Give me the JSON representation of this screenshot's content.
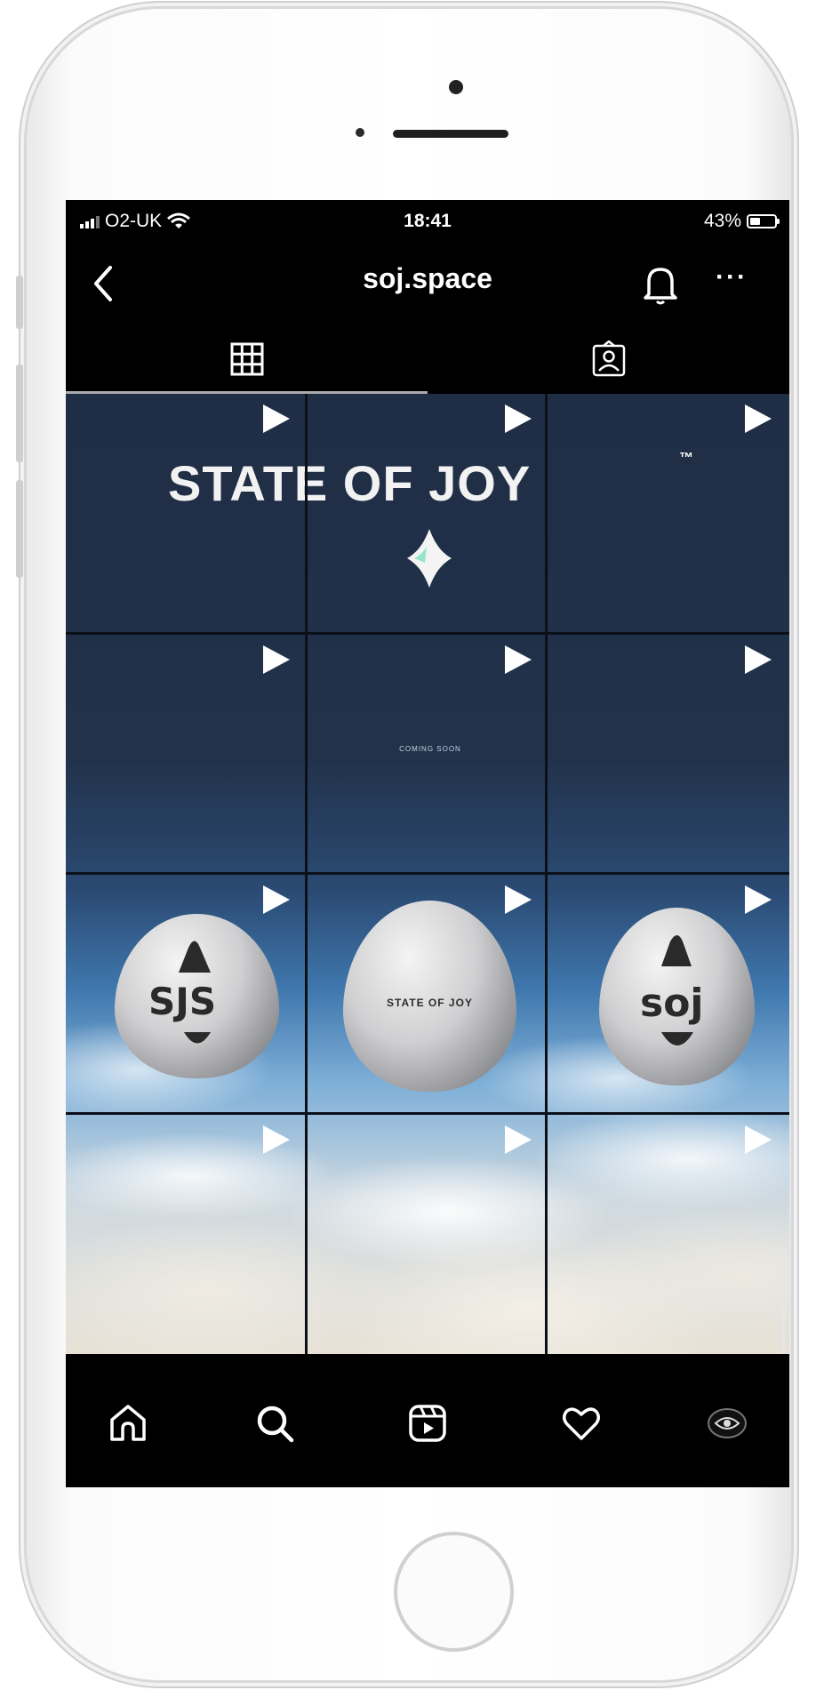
{
  "status_bar": {
    "carrier": "O2-UK",
    "time": "18:41",
    "battery": "43%",
    "battery_level": 0.43
  },
  "header": {
    "title": "soj.space",
    "back_icon": "chevron-left-icon",
    "notification_icon": "bell-icon",
    "more_label": "···"
  },
  "tabs": [
    {
      "icon": "grid-icon",
      "selected": true
    },
    {
      "icon": "tagged-person-icon",
      "selected": false
    }
  ],
  "grid": {
    "banner_title": "STATE OF JOY",
    "banner_mark": "™",
    "coming_soon": "COMING SOON",
    "egg_label": "STATE OF JOY",
    "egg_mark_left": "SJS",
    "egg_mark_right": "soj",
    "post_icon": "play-icon",
    "posts_count": 12
  },
  "bottom_nav": [
    {
      "icon": "home-icon"
    },
    {
      "icon": "search-icon"
    },
    {
      "icon": "reels-icon"
    },
    {
      "icon": "heart-icon"
    },
    {
      "icon": "profile-avatar"
    }
  ],
  "colors": {
    "screen_bg": "#000000",
    "text": "#ffffff",
    "night_sky": "#1f2d45",
    "day_sky": "#3f77ad"
  }
}
